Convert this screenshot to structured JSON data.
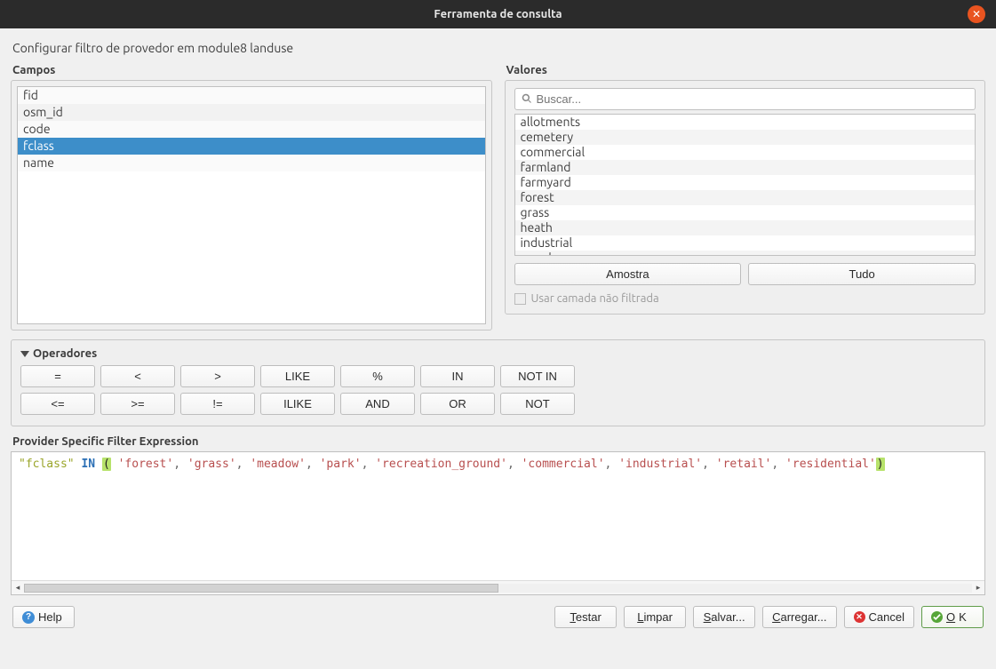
{
  "window": {
    "title": "Ferramenta de consulta"
  },
  "header": {
    "subtitle": "Configurar filtro de provedor em module8 landuse"
  },
  "fields": {
    "label": "Campos",
    "items": [
      "fid",
      "osm_id",
      "code",
      "fclass",
      "name"
    ],
    "selected": "fclass"
  },
  "values": {
    "label": "Valores",
    "search_placeholder": "Buscar...",
    "items": [
      "allotments",
      "cemetery",
      "commercial",
      "farmland",
      "farmyard",
      "forest",
      "grass",
      "heath",
      "industrial",
      "meadow"
    ],
    "sample_btn": "Amostra",
    "all_btn": "Tudo",
    "use_unfiltered_layer": "Usar camada não filtrada"
  },
  "operators": {
    "label": "Operadores",
    "row1": [
      "=",
      "<",
      ">",
      "LIKE",
      "%",
      "IN",
      "NOT IN"
    ],
    "row2": [
      "<=",
      ">=",
      "!=",
      "ILIKE",
      "AND",
      "OR",
      "NOT"
    ]
  },
  "expression": {
    "label": "Provider Specific Filter Expression",
    "tokens": {
      "field": "\"fclass\"",
      "keyword": "IN",
      "values": [
        "'forest'",
        "'grass'",
        "'meadow'",
        "'park'",
        "'recreation_ground'",
        "'commercial'",
        "'industrial'",
        "'retail'",
        "'residential'"
      ]
    }
  },
  "buttons": {
    "help": "Help",
    "test": "Testar",
    "clear": "Limpar",
    "save": "Salvar...",
    "load": "Carregar...",
    "cancel": "Cancel",
    "ok": "OK"
  }
}
